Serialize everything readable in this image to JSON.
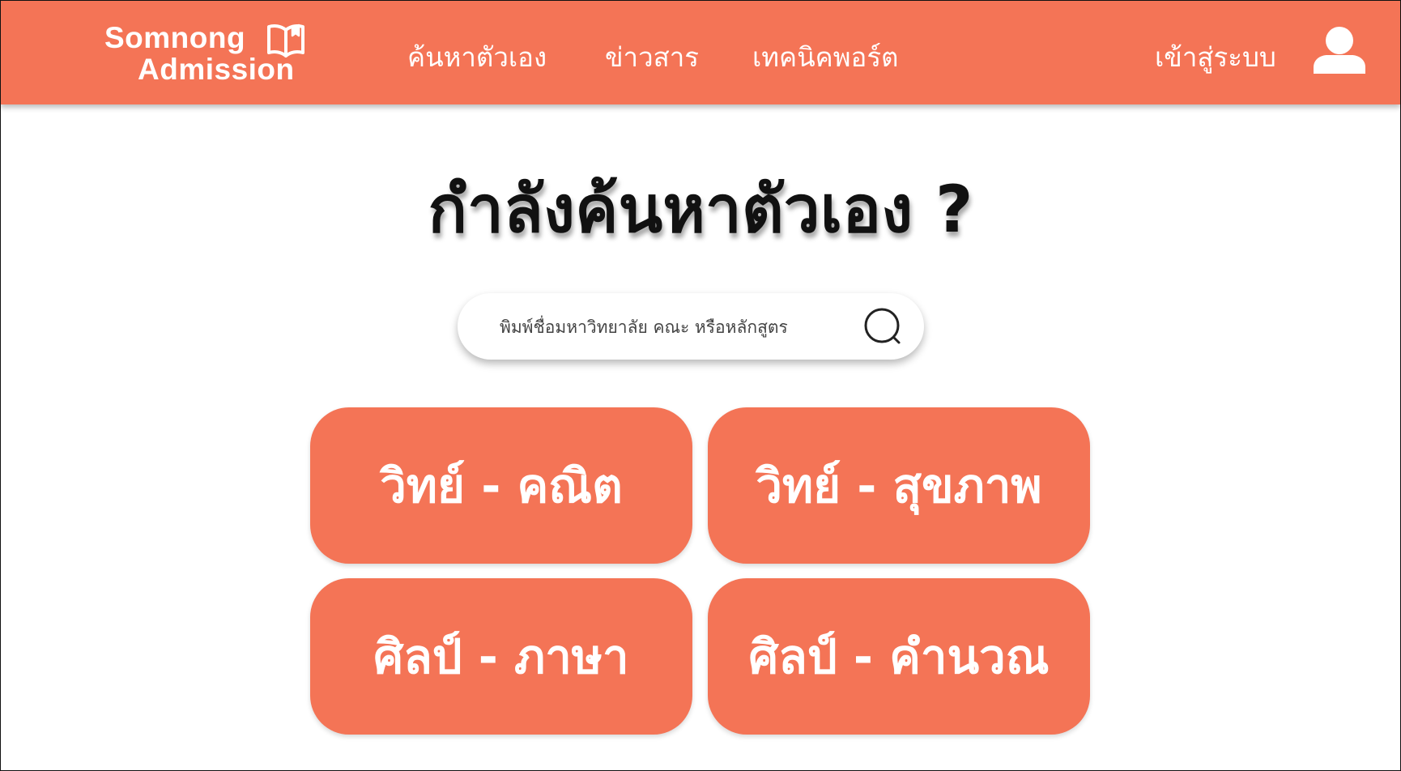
{
  "brand": {
    "line1": "Somnong",
    "line2": "Admission",
    "icon": "open-book-icon"
  },
  "nav": {
    "links": [
      {
        "label": "ค้นหาตัวเอง"
      },
      {
        "label": "ข่าวสาร"
      },
      {
        "label": "เทคนิคพอร์ต"
      }
    ],
    "login_label": "เข้าสู่ระบบ",
    "user_icon": "user-icon"
  },
  "hero": {
    "title": "กำลังค้นหาตัวเอง ?"
  },
  "search": {
    "placeholder": "พิมพ์ชื่อมหาวิทยาลัย คณะ หรือหลักสูตร",
    "value": "",
    "icon": "search-icon"
  },
  "categories": [
    {
      "label": "วิทย์ - คณิต"
    },
    {
      "label": "วิทย์ - สุขภาพ"
    },
    {
      "label": "ศิลป์ - ภาษา"
    },
    {
      "label": "ศิลป์ - คำนวณ"
    }
  ],
  "colors": {
    "accent": "#f47456",
    "text": "#111111",
    "background": "#ffffff"
  }
}
